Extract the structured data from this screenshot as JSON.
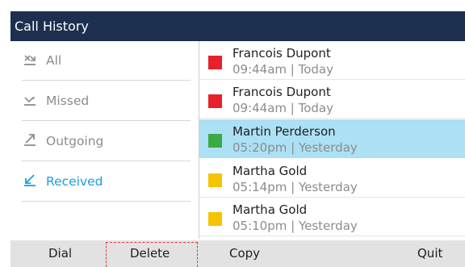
{
  "title": "Call History",
  "sidebar": {
    "items": [
      {
        "label": "All",
        "icon": "all-calls-icon",
        "active": false
      },
      {
        "label": "Missed",
        "icon": "missed-call-icon",
        "active": false
      },
      {
        "label": "Outgoing",
        "icon": "outgoing-call-icon",
        "active": false
      },
      {
        "label": "Received",
        "icon": "received-call-icon",
        "active": true
      }
    ]
  },
  "calls": [
    {
      "name": "Francois Dupont",
      "time": "09:44am | Today",
      "status_color": "#e8202a",
      "selected": false
    },
    {
      "name": "Francois Dupont",
      "time": "09:44am | Today",
      "status_color": "#e8202a",
      "selected": false
    },
    {
      "name": "Martin Perderson",
      "time": "05:20pm | Yesterday",
      "status_color": "#3aaa45",
      "selected": true
    },
    {
      "name": "Martha Gold",
      "time": "05:14pm | Yesterday",
      "status_color": "#f5c400",
      "selected": false
    },
    {
      "name": "Martha Gold",
      "time": "05:10pm | Yesterday",
      "status_color": "#f5c400",
      "selected": false
    }
  ],
  "softkeys": {
    "dial": "Dial",
    "delete": "Delete",
    "copy": "Copy",
    "quit": "Quit"
  },
  "colors": {
    "titlebar": "#1d2f4f",
    "active": "#1b9ce0",
    "selected_row": "#ace0f4"
  }
}
